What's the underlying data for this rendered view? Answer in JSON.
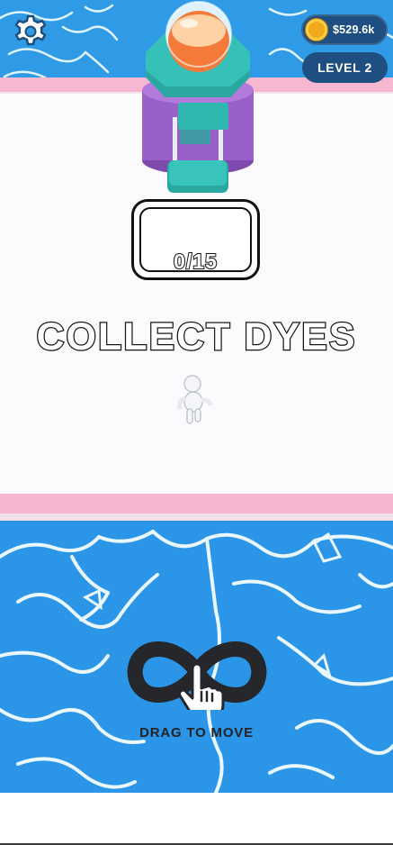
{
  "hud": {
    "settings_icon": "gear-icon",
    "coin_icon": "coin-icon",
    "coins": "$529.6k",
    "level": "LEVEL 2"
  },
  "tray": {
    "count": "0/15"
  },
  "instruction": {
    "title": "COLLECT DYES",
    "hint": "DRAG TO MOVE",
    "hint_icon": "infinity-hand-icon"
  },
  "colors": {
    "water": "#2b95e8",
    "rail": "#f7b6cf",
    "hud_pill": "#1e4f80",
    "machine_teal": "#2fb8b0",
    "machine_purple": "#9a60c9",
    "dye_orange": "#f47a3a"
  }
}
